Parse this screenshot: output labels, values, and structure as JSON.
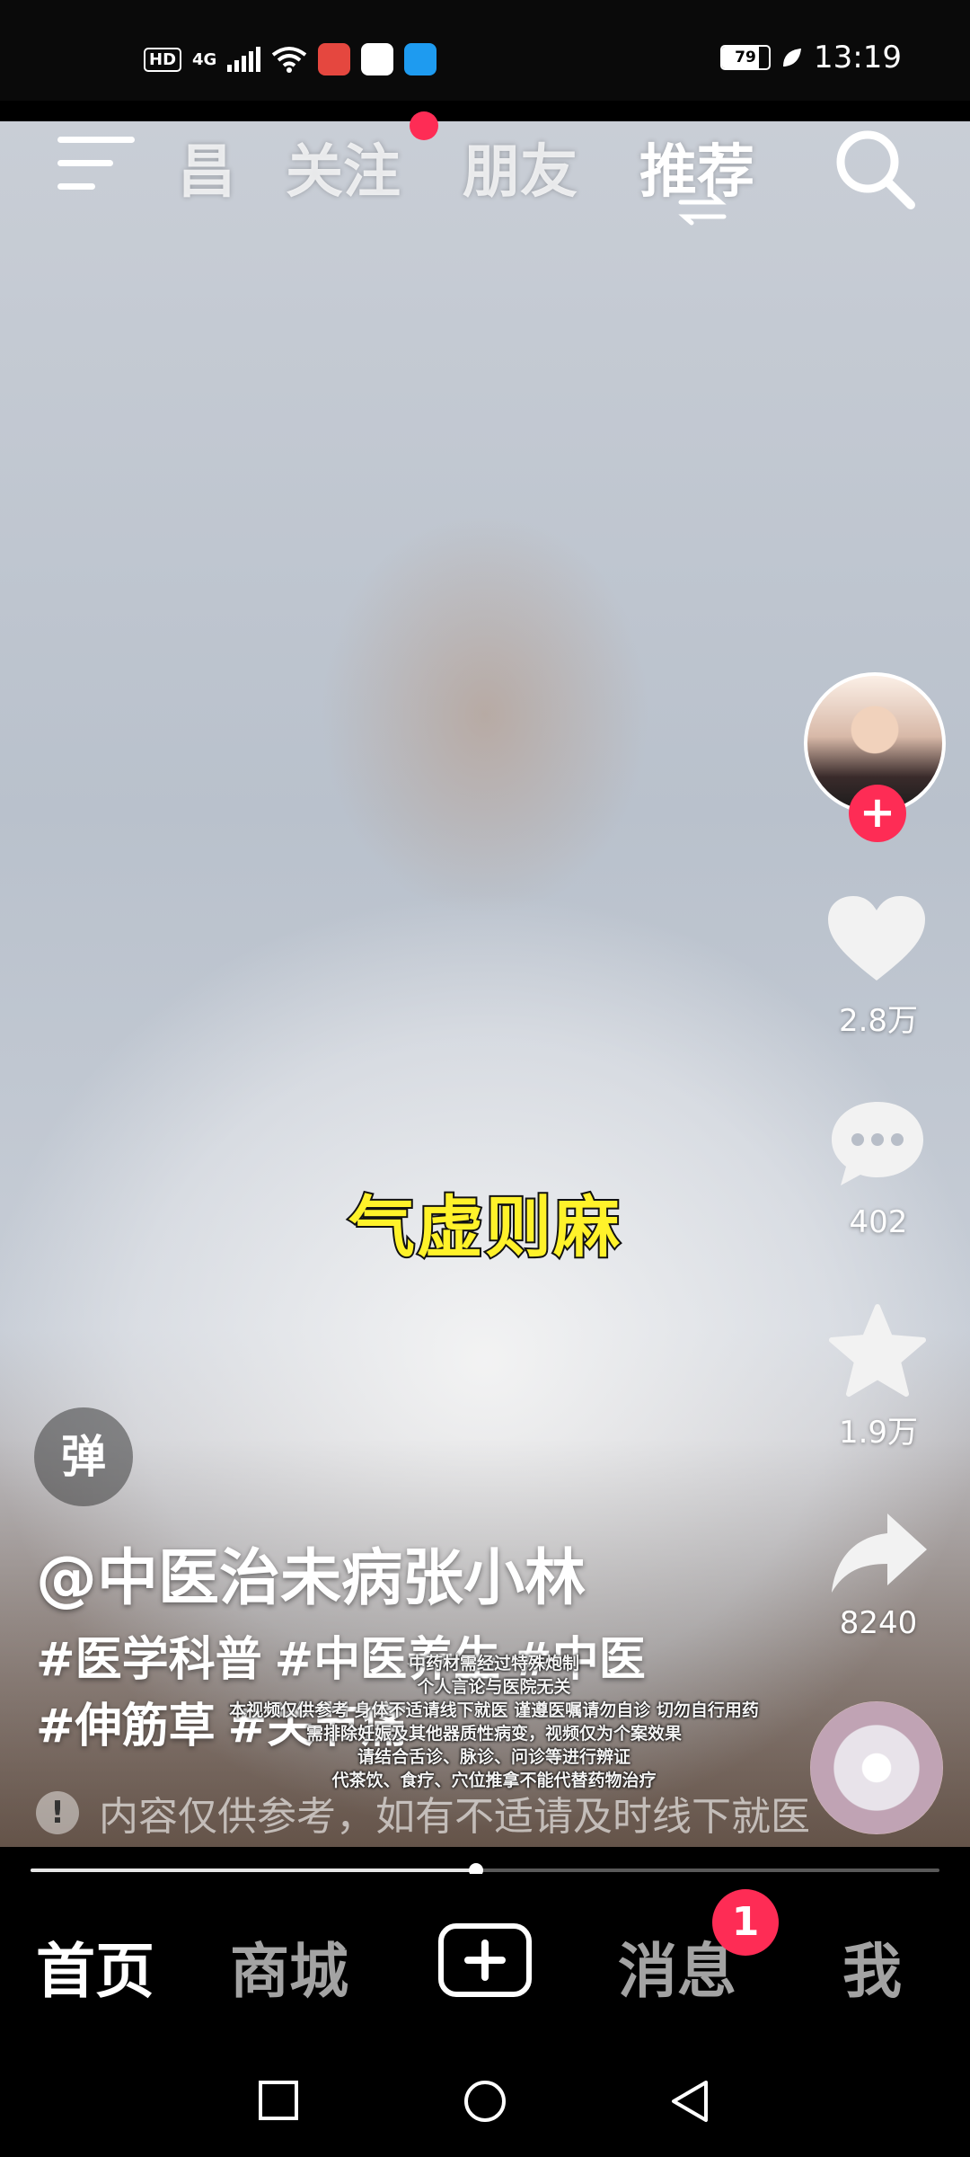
{
  "status_bar": {
    "time": "13:19",
    "battery": "79",
    "battery_fraction": 0.79,
    "hd": "HD",
    "network": "4G",
    "app_badge_colors": [
      "#e5473f",
      "#ffffff",
      "#1e9bf0"
    ]
  },
  "top_nav": {
    "city_tab": "昌",
    "tabs": [
      "关注",
      "朋友",
      "推荐"
    ],
    "active_tab": "推荐",
    "notification_dot_color": "#fe2c55"
  },
  "video": {
    "subtitle": "气虚则麻",
    "author": "@中医治未病张小林",
    "hashtags": [
      "#医学科普",
      "#中医养生",
      "#中医",
      "#伸筋草",
      "#关节痛"
    ],
    "disclaimer_lines": [
      "中药材需经过特殊炮制",
      "个人言论与医院无关",
      "本视频仅供参考 身体不适请线下就医 谨遵医嘱请勿自诊 切勿自行用药",
      "需排除妊娠及其他器质性病变，视频仅为个案效果",
      "请结合舌诊、脉诊、问诊等进行辨证",
      "代茶饮、食疗、穴位推拿不能代替药物治疗"
    ],
    "notice": "内容仅供参考，如有不适请及时线下就医",
    "danmaku_label": "弹",
    "progress_fraction": 0.49
  },
  "right_rail": {
    "likes": "2.8万",
    "comments": "402",
    "favorites": "1.9万",
    "shares": "8240",
    "follow_label": "+"
  },
  "bottom_nav": {
    "tabs": [
      "首页",
      "商城",
      "消息",
      "我"
    ],
    "active_tab": "首页",
    "message_badge": "1"
  },
  "colors": {
    "accent": "#fe2c55",
    "subtitle_fill": "#fff22a",
    "inactive_tab": "#a3a3a3"
  },
  "icons": {
    "menu": "menu-icon",
    "search": "search-icon",
    "like": "heart-icon",
    "comment": "comment-icon",
    "favorite": "star-icon",
    "share": "share-icon",
    "create": "plus-square-icon",
    "system": [
      "square-icon",
      "circle-icon",
      "back-triangle-icon"
    ]
  }
}
